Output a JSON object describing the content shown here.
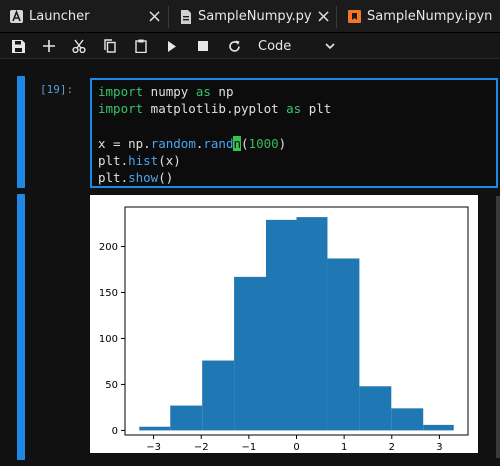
{
  "tabs": [
    {
      "label": "Launcher",
      "icon": "launcher-icon"
    },
    {
      "label": "SampleNumpy.py",
      "icon": "python-file-icon"
    },
    {
      "label": "SampleNumpy.ipyn",
      "icon": "notebook-icon"
    }
  ],
  "toolbar": {
    "buttons": [
      "save-icon",
      "add-cell-icon",
      "cut-icon",
      "copy-icon",
      "paste-icon",
      "run-icon",
      "stop-icon",
      "restart-icon"
    ],
    "cell_type": "Code"
  },
  "cell": {
    "prompt": "[19]:",
    "code": [
      {
        "parts": [
          [
            "kw",
            "import"
          ],
          [
            "t",
            " numpy "
          ],
          [
            "kw",
            "as"
          ],
          [
            "t",
            " np"
          ]
        ]
      },
      {
        "parts": [
          [
            "kw",
            "import"
          ],
          [
            "t",
            " matplotlib.pyplot "
          ],
          [
            "kw",
            "as"
          ],
          [
            "t",
            " plt"
          ]
        ]
      },
      {
        "parts": []
      },
      {
        "parts": [
          [
            "t",
            "x = np."
          ],
          [
            "fn",
            "random"
          ],
          [
            "t",
            "."
          ],
          [
            "fn",
            "rand"
          ],
          [
            "cur",
            "n"
          ],
          [
            "t",
            "("
          ],
          [
            "num",
            "1000"
          ],
          [
            "t",
            ")"
          ]
        ]
      },
      {
        "parts": [
          [
            "t",
            "plt."
          ],
          [
            "fn",
            "hist"
          ],
          [
            "t",
            "(x)"
          ]
        ]
      },
      {
        "parts": [
          [
            "t",
            "plt."
          ],
          [
            "fn",
            "show"
          ],
          [
            "t",
            "()"
          ]
        ]
      }
    ]
  },
  "chart_data": {
    "type": "bar",
    "bin_edges": [
      -3.3,
      -2.65,
      -1.98,
      -1.31,
      -0.64,
      0.0,
      0.65,
      1.32,
      1.99,
      2.66,
      3.3
    ],
    "values": [
      4,
      27,
      76,
      167,
      229,
      232,
      187,
      48,
      24,
      6
    ],
    "xticks": [
      "-3",
      "-2",
      "-1",
      "0",
      "1",
      "2",
      "3"
    ],
    "yticks": [
      "0",
      "50",
      "100",
      "150",
      "200"
    ],
    "xlim": [
      -3.6,
      3.6
    ],
    "ylim": [
      -5,
      243
    ],
    "color": "#1f77b4",
    "grid": false
  }
}
